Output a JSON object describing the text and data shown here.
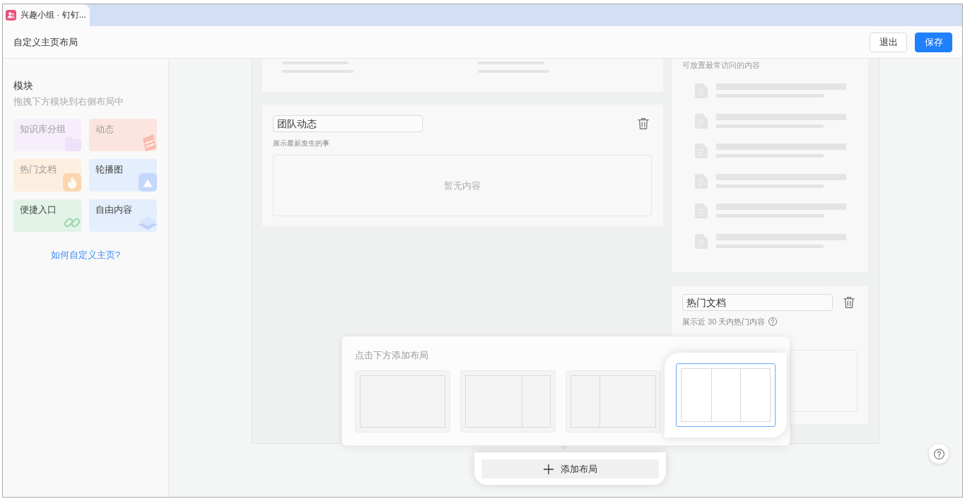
{
  "browser_tab": {
    "title": "兴趣小组 · 钉钉..."
  },
  "header": {
    "title": "自定义主页布局",
    "buttons": [
      {
        "label": "退出",
        "kind": "secondary"
      },
      {
        "label": "保存",
        "kind": "primary"
      }
    ]
  },
  "sidebar": {
    "title": "模块",
    "hint": "拖拽下方模块到右侧布局中",
    "modules": [
      {
        "label": "知识库分组",
        "kind": "group",
        "color": "#f6eefb",
        "disabled": true
      },
      {
        "label": "动态",
        "kind": "feed",
        "color": "#fce5e0",
        "disabled": true
      },
      {
        "label": "热门文档",
        "kind": "hot",
        "color": "#fdefdf",
        "disabled": true
      },
      {
        "label": "轮播图",
        "kind": "carousel",
        "color": "#e4eefc",
        "disabled": false
      },
      {
        "label": "便捷入口",
        "kind": "shortcut",
        "color": "#e2f3e7",
        "disabled": false
      },
      {
        "label": "自由内容",
        "kind": "free",
        "color": "#e5eefc",
        "disabled": false
      }
    ],
    "help_link": "如何自定义主页?"
  },
  "canvas": {
    "feed_card": {
      "title": "团队动态",
      "description": "展示最新发生的事",
      "empty_text": "暂无内容"
    },
    "frequent_card": {
      "description": "可放置最常访问的内容"
    },
    "hot_card": {
      "title": "热门文档",
      "description": "展示近 30 天内热门内容"
    }
  },
  "layout_popup": {
    "title": "点击下方添加布局",
    "layouts": [
      {
        "kind": "single",
        "selected": false
      },
      {
        "kind": "wide-narrow",
        "selected": false
      },
      {
        "kind": "narrow-wide",
        "selected": false
      },
      {
        "kind": "three",
        "selected": true
      }
    ]
  },
  "add_layout_button": {
    "label": "添加布局"
  }
}
